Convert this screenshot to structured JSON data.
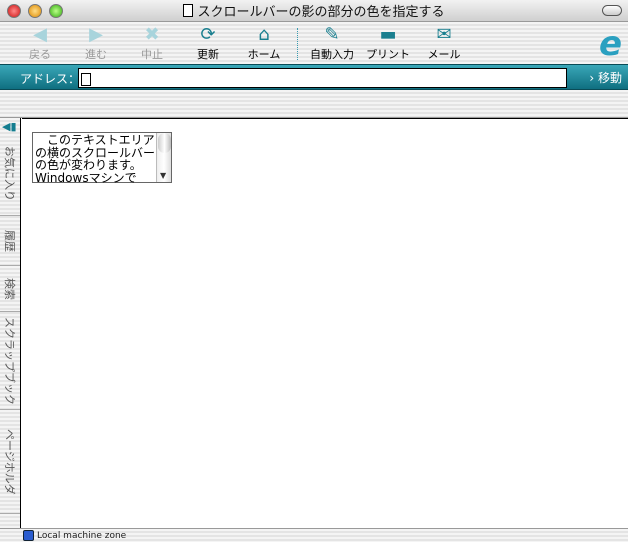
{
  "window": {
    "title": "スクロールバーの影の部分の色を指定する"
  },
  "toolbar": {
    "back": "戻る",
    "forward": "進む",
    "stop": "中止",
    "refresh": "更新",
    "home": "ホーム",
    "autofill": "自動入力",
    "print": "プリント",
    "mail": "メール"
  },
  "address": {
    "label": "アドレス：",
    "value": "",
    "go": "移動"
  },
  "sidebar": {
    "tabs": [
      "お気に入り",
      "履歴",
      "検索",
      "スクラップブック",
      "ページホルダ"
    ]
  },
  "content": {
    "textarea_text": "　このテキストエリアの横のスクロールバーの色が変わります。Windowsマシンで"
  },
  "status": {
    "zone": "Local machine zone"
  }
}
